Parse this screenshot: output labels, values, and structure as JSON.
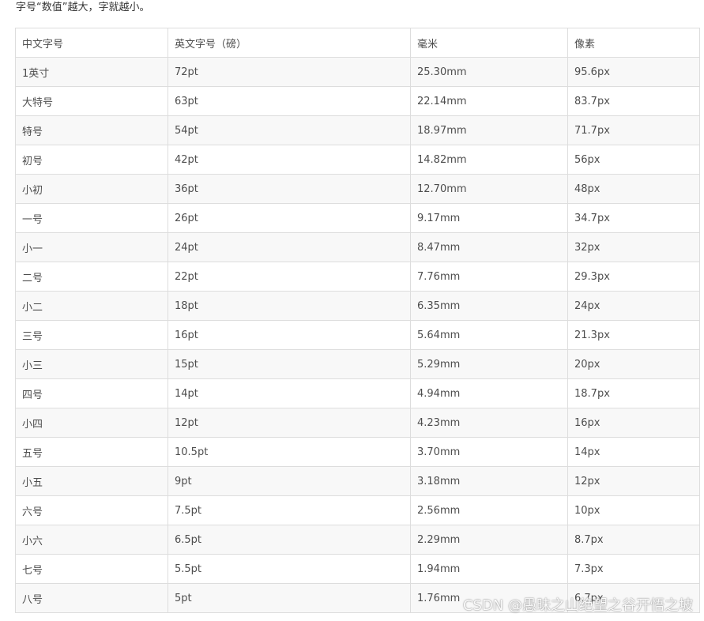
{
  "intro_text": "字号“数值”越大，字就越小。",
  "table": {
    "headers": [
      "中文字号",
      "英文字号（磅）",
      "毫米",
      "像素"
    ],
    "rows": [
      [
        "1英寸",
        "72pt",
        "25.30mm",
        "95.6px"
      ],
      [
        "大特号",
        "63pt",
        "22.14mm",
        "83.7px"
      ],
      [
        "特号",
        "54pt",
        "18.97mm",
        "71.7px"
      ],
      [
        "初号",
        "42pt",
        "14.82mm",
        "56px"
      ],
      [
        "小初",
        "36pt",
        "12.70mm",
        "48px"
      ],
      [
        "一号",
        "26pt",
        "9.17mm",
        "34.7px"
      ],
      [
        "小一",
        "24pt",
        "8.47mm",
        "32px"
      ],
      [
        "二号",
        "22pt",
        "7.76mm",
        "29.3px"
      ],
      [
        "小二",
        "18pt",
        "6.35mm",
        "24px"
      ],
      [
        "三号",
        "16pt",
        "5.64mm",
        "21.3px"
      ],
      [
        "小三",
        "15pt",
        "5.29mm",
        "20px"
      ],
      [
        "四号",
        "14pt",
        "4.94mm",
        "18.7px"
      ],
      [
        "小四",
        "12pt",
        "4.23mm",
        "16px"
      ],
      [
        "五号",
        "10.5pt",
        "3.70mm",
        "14px"
      ],
      [
        "小五",
        "9pt",
        "3.18mm",
        "12px"
      ],
      [
        "六号",
        "7.5pt",
        "2.56mm",
        "10px"
      ],
      [
        "小六",
        "6.5pt",
        "2.29mm",
        "8.7px"
      ],
      [
        "七号",
        "5.5pt",
        "1.94mm",
        "7.3px"
      ],
      [
        "八号",
        "5pt",
        "1.76mm",
        "6.7px"
      ]
    ]
  },
  "watermark": "CSDN @愚昧之山绝望之谷开悟之坡",
  "colors": {
    "border": "#dddddd",
    "stripe": "#f8f8f8",
    "text": "#4d4d4d"
  }
}
